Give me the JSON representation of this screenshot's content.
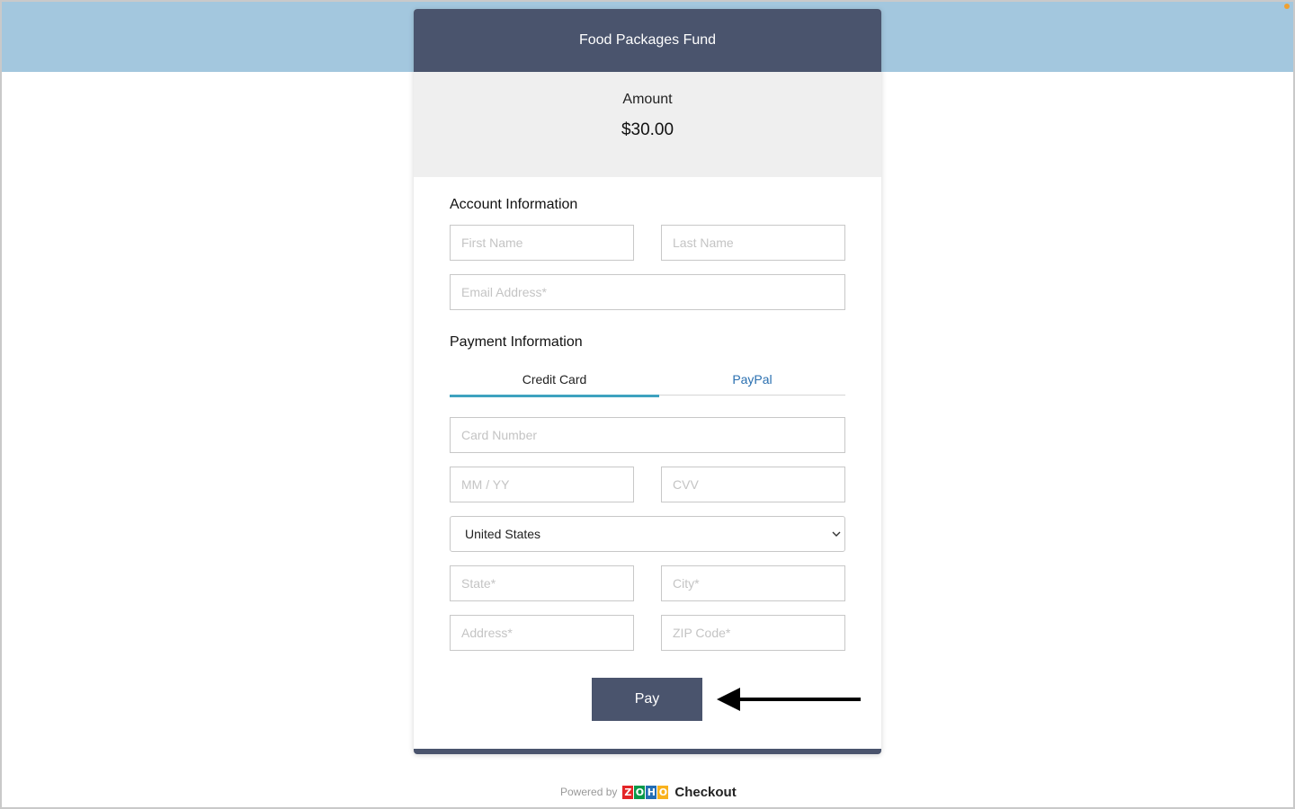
{
  "form": {
    "title": "Food Packages Fund",
    "amount_label": "Amount",
    "amount_value": "$30.00"
  },
  "account": {
    "section_title": "Account Information",
    "first_name_placeholder": "First Name",
    "last_name_placeholder": "Last Name",
    "email_placeholder": "Email Address*"
  },
  "payment": {
    "section_title": "Payment Information",
    "tabs": [
      {
        "label": "Credit Card",
        "active": true
      },
      {
        "label": "PayPal",
        "active": false
      }
    ],
    "card_number_placeholder": "Card Number",
    "expiry_placeholder": "MM / YY",
    "cvv_placeholder": "CVV",
    "country_value": "United States",
    "state_placeholder": "State*",
    "city_placeholder": "City*",
    "address_placeholder": "Address*",
    "zip_placeholder": "ZIP Code*",
    "pay_label": "Pay"
  },
  "footer": {
    "powered_by": "Powered by",
    "zoho_letters": [
      "Z",
      "O",
      "H",
      "O"
    ],
    "product": "Checkout"
  },
  "colors": {
    "header_bg": "#4a546d",
    "top_band": "#a3c7de",
    "tab_active_underline": "#3ea2bf",
    "paypal_link": "#2a6fb0",
    "zoho_z": "#e42527",
    "zoho_o1": "#089949",
    "zoho_h": "#226db4",
    "zoho_o2": "#f9b21d"
  },
  "icons": [
    "chevron-down-icon",
    "arrow-left-icon",
    "zoho-logo"
  ]
}
